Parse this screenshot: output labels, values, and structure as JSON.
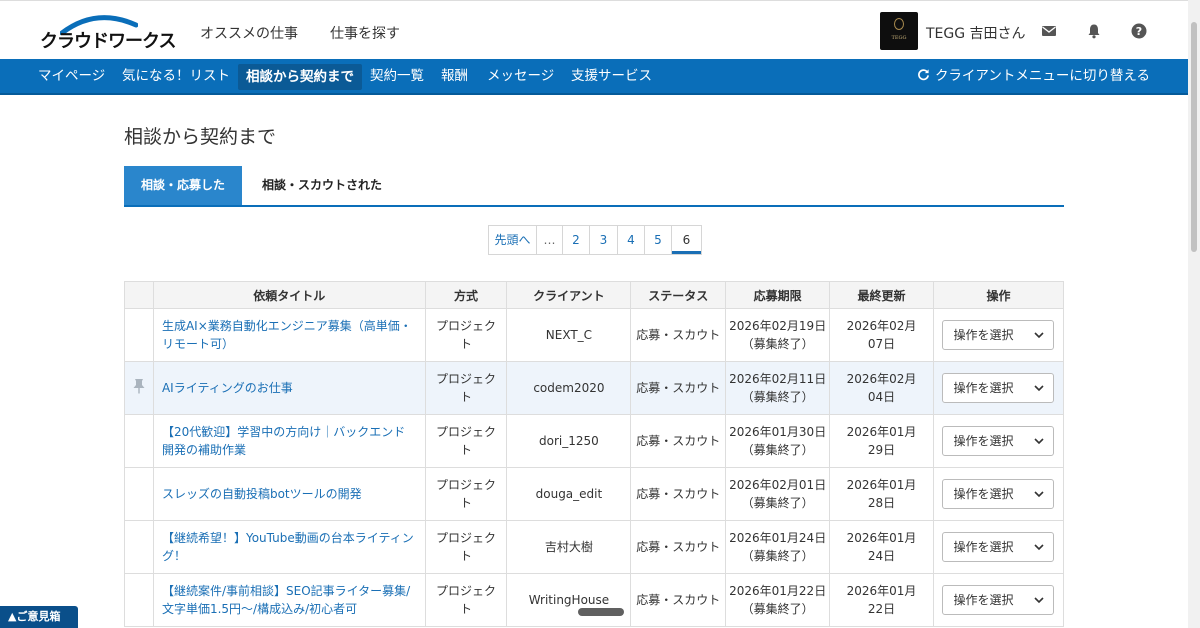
{
  "header": {
    "logo_text": "クラウドワークス",
    "links": [
      "オススメの仕事",
      "仕事を探す"
    ],
    "avatar_label": "TEGG",
    "user_name": "TEGG 吉田さん",
    "icons": [
      "mail-icon",
      "bell-icon",
      "help-icon"
    ]
  },
  "nav": {
    "items": [
      "マイページ",
      "気になる！リスト",
      "相談から契約まで",
      "契約一覧",
      "報酬",
      "メッセージ",
      "支援サービス"
    ],
    "active_index": 2,
    "switch_label": "クライアントメニューに切り替える"
  },
  "page": {
    "title": "相談から契約まで",
    "tabs": [
      "相談・応募した",
      "相談・スカウトされた"
    ]
  },
  "pager": {
    "items": [
      "先頭へ",
      "…",
      "2",
      "3",
      "4",
      "5",
      "6"
    ],
    "current": "6"
  },
  "table": {
    "headers": [
      "依頼タイトル",
      "方式",
      "クライアント",
      "ステータス",
      "応募期限",
      "最終更新",
      "操作"
    ],
    "select_label": "操作を選択",
    "rows": [
      {
        "title": "生成AI×業務自動化エンジニア募集（高単価・リモート可）",
        "method": "プロジェクト",
        "client": "NEXT_C",
        "status": "応募・スカウト",
        "deadline": "2026年02月19日",
        "deadline_note": "（募集終了）",
        "updated": "2026年02月07日",
        "pinned": false
      },
      {
        "title": "AIライティングのお仕事",
        "method": "プロジェクト",
        "client": "codem2020",
        "status": "応募・スカウト",
        "deadline": "2026年02月11日",
        "deadline_note": "（募集終了）",
        "updated": "2026年02月04日",
        "pinned": true
      },
      {
        "title": "【20代歓迎】学習中の方向け｜バックエンド開発の補助作業",
        "method": "プロジェクト",
        "client": "dori_1250",
        "status": "応募・スカウト",
        "deadline": "2026年01月30日",
        "deadline_note": "（募集終了）",
        "updated": "2026年01月29日",
        "pinned": false
      },
      {
        "title": "スレッズの自動投稿botツールの開発",
        "method": "プロジェクト",
        "client": "douga_edit",
        "status": "応募・スカウト",
        "deadline": "2026年02月01日",
        "deadline_note": "（募集終了）",
        "updated": "2026年01月28日",
        "pinned": false
      },
      {
        "title": "【継続希望！】YouTube動画の台本ライティング！",
        "method": "プロジェクト",
        "client": "吉村大樹",
        "status": "応募・スカウト",
        "deadline": "2026年01月24日",
        "deadline_note": "（募集終了）",
        "updated": "2026年01月24日",
        "pinned": false
      },
      {
        "title": "【継続案件/事前相談】SEO記事ライター募集/文字単価1.5円〜/構成込み/初心者可",
        "method": "プロジェクト",
        "client": "WritingHouse",
        "status": "応募・スカウト",
        "deadline": "2026年01月22日",
        "deadline_note": "（募集終了）",
        "updated": "2026年01月22日",
        "pinned": false
      }
    ]
  },
  "feedback_label": "▲ご意見箱",
  "colors": {
    "brand_blue": "#0a6eb9",
    "link_blue": "#1a6fb5",
    "highlight_row": "#eef4fb"
  }
}
